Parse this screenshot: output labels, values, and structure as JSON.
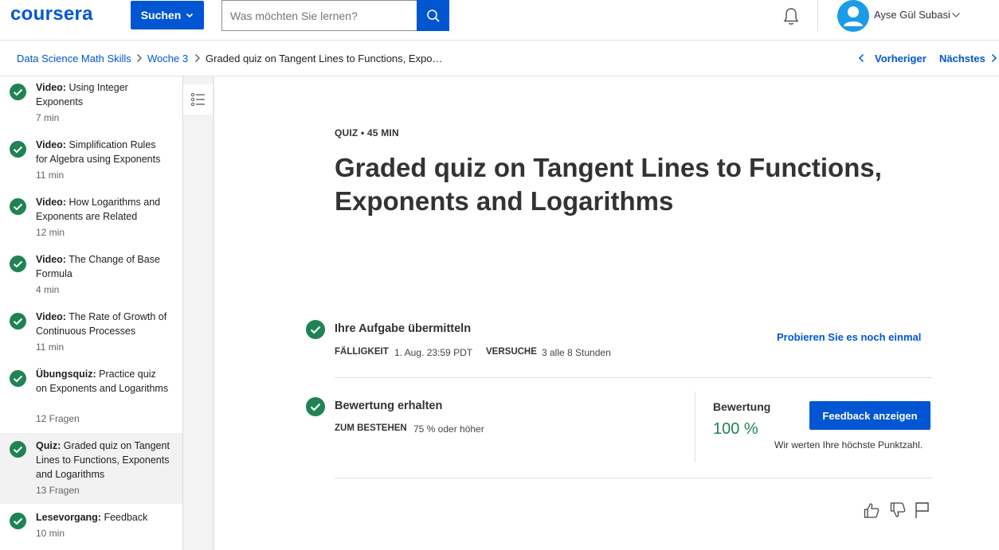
{
  "header": {
    "logo": "coursera",
    "browse_label": "Suchen",
    "search_placeholder": "Was möchten Sie lernen?",
    "user_name": "Ayse Gül Subasi"
  },
  "breadcrumb": {
    "items": [
      "Data Science Math Skills",
      "Woche 3",
      "Graded quiz on Tangent Lines to Functions, Expo…"
    ],
    "previous": "Vorheriger",
    "next": "Nächstes"
  },
  "sidebar": {
    "items": [
      {
        "type": "Video:",
        "title": "Using Integer Exponents",
        "meta": "7 min"
      },
      {
        "type": "Video:",
        "title": "Simplification Rules for Algebra using Exponents",
        "meta": "11 min"
      },
      {
        "type": "Video:",
        "title": "How Logarithms and Exponents are Related",
        "meta": "12 min"
      },
      {
        "type": "Video:",
        "title": "The Change of Base Formula",
        "meta": "4 min"
      },
      {
        "type": "Video:",
        "title": "The Rate of Growth of Continuous Processes",
        "meta": "11 min"
      },
      {
        "type": "Übungsquiz:",
        "title": "Practice quiz on Exponents and Logarithms",
        "meta": "12 Fragen"
      },
      {
        "type": "Quiz:",
        "title": "Graded quiz on Tangent Lines to Functions, Exponents and Logarithms",
        "meta": "13 Fragen"
      },
      {
        "type": "Lesevorgang:",
        "title": "Feedback",
        "meta": "10 min"
      }
    ]
  },
  "main": {
    "eyebrow": "QUIZ • 45 MIN",
    "title": "Graded quiz on Tangent Lines to Functions, Exponents and Logarithms",
    "submit": {
      "title": "Ihre Aufgabe übermitteln",
      "due_label": "FÄLLIGKEIT",
      "due_value": "1. Aug. 23:59 PDT",
      "attempts_label": "VERSUCHE",
      "attempts_value": "3 alle 8 Stunden",
      "retry": "Probieren Sie es noch einmal"
    },
    "grade": {
      "title": "Bewertung erhalten",
      "pass_label": "ZUM BESTEHEN",
      "pass_value": "75 % oder höher",
      "grade_label": "Bewertung",
      "grade_value": "100 %",
      "feedback_button": "Feedback anzeigen",
      "note": "Wir werten Ihre höchste Punktzahl."
    }
  },
  "colors": {
    "brand": "#0056d2",
    "success": "#1f8354"
  }
}
